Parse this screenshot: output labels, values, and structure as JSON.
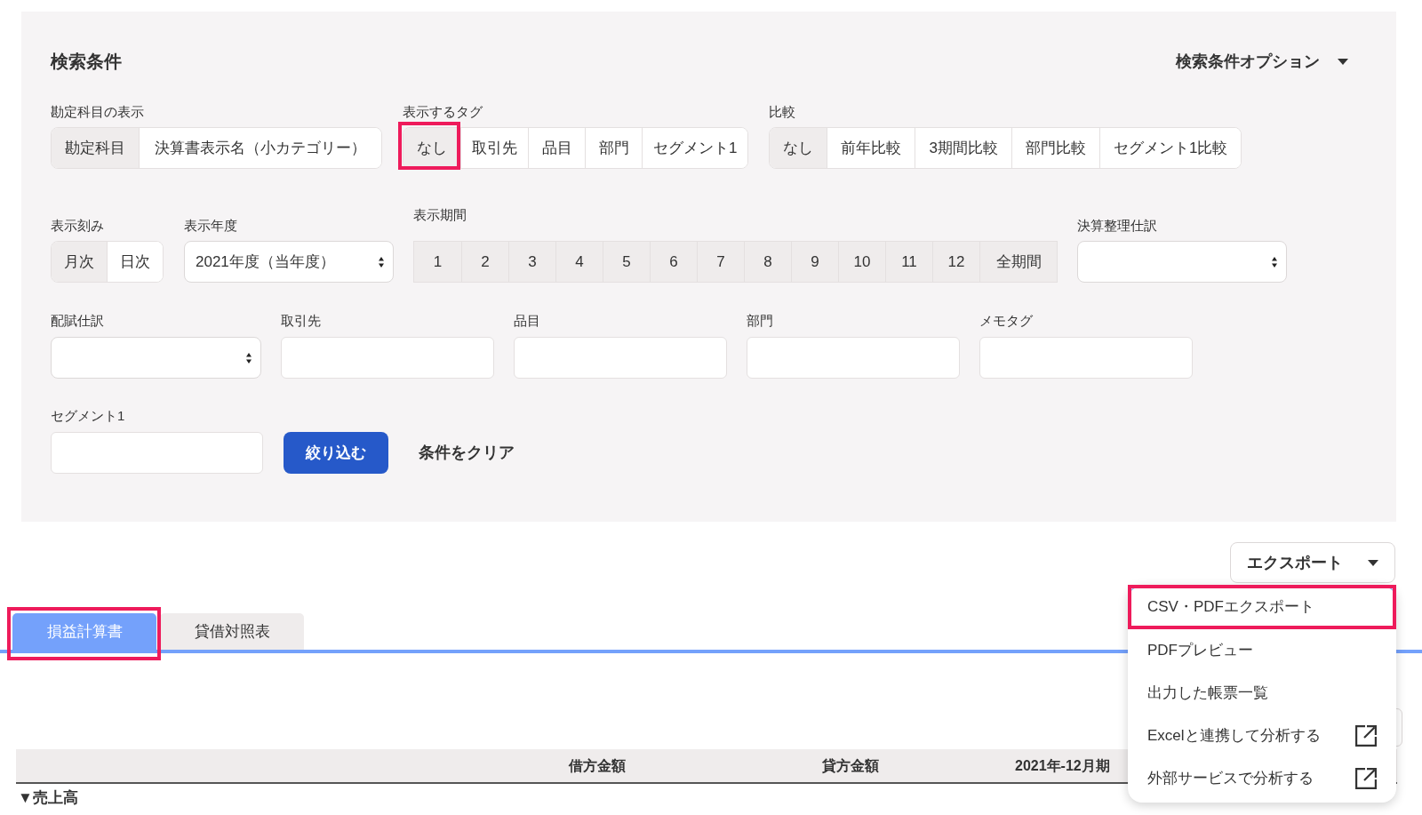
{
  "search_panel": {
    "title": "検索条件",
    "options_toggle": "検索条件オプション",
    "account_display": {
      "label": "勘定科目の表示",
      "options": [
        {
          "label": "勘定科目",
          "selected": true
        },
        {
          "label": "決算書表示名（小カテゴリー）",
          "selected": false
        }
      ]
    },
    "display_tags": {
      "label": "表示するタグ",
      "options": [
        {
          "label": "なし",
          "selected": true,
          "highlighted": true
        },
        {
          "label": "取引先",
          "selected": false,
          "highlighted": false
        },
        {
          "label": "品目",
          "selected": false,
          "highlighted": false
        },
        {
          "label": "部門",
          "selected": false,
          "highlighted": false
        },
        {
          "label": "セグメント1",
          "selected": false,
          "highlighted": false
        }
      ]
    },
    "comparison": {
      "label": "比較",
      "options": [
        {
          "label": "なし",
          "selected": true
        },
        {
          "label": "前年比較",
          "selected": false
        },
        {
          "label": "3期間比較",
          "selected": false
        },
        {
          "label": "部門比較",
          "selected": false
        },
        {
          "label": "セグメント1比較",
          "selected": false
        }
      ]
    },
    "granularity": {
      "label": "表示刻み",
      "options": [
        {
          "label": "月次",
          "selected": true
        },
        {
          "label": "日次",
          "selected": false
        }
      ]
    },
    "fiscal_year": {
      "label": "表示年度",
      "value": "2021年度（当年度）"
    },
    "period": {
      "label": "表示期間",
      "options": [
        {
          "label": "1",
          "selected": true
        },
        {
          "label": "2",
          "selected": true
        },
        {
          "label": "3",
          "selected": true
        },
        {
          "label": "4",
          "selected": true
        },
        {
          "label": "5",
          "selected": true
        },
        {
          "label": "6",
          "selected": true
        },
        {
          "label": "7",
          "selected": true
        },
        {
          "label": "8",
          "selected": true
        },
        {
          "label": "9",
          "selected": true
        },
        {
          "label": "10",
          "selected": true
        },
        {
          "label": "11",
          "selected": true
        },
        {
          "label": "12",
          "selected": true
        },
        {
          "label": "全期間",
          "selected": true
        }
      ]
    },
    "closing_entries": {
      "label": "決算整理仕訳"
    },
    "allocation_entries": {
      "label": "配賦仕訳"
    },
    "filters": [
      {
        "label": "取引先"
      },
      {
        "label": "品目"
      },
      {
        "label": "部門"
      },
      {
        "label": "メモタグ"
      }
    ],
    "segment1": {
      "label": "セグメント1"
    },
    "apply_button": "絞り込む",
    "clear_link": "条件をクリア"
  },
  "export": {
    "label": "エクスポート",
    "expanded": true,
    "menu": [
      {
        "label": "CSV・PDFエクスポート",
        "kind": "internal",
        "highlighted": true
      },
      {
        "label": "PDFプレビュー",
        "kind": "internal",
        "highlighted": false
      },
      {
        "label": "出力した帳票一覧",
        "kind": "internal",
        "highlighted": false
      },
      {
        "label": "Excelと連携して分析する",
        "kind": "external",
        "highlighted": false
      },
      {
        "label": "外部サービスで分析する",
        "kind": "external",
        "highlighted": false
      }
    ]
  },
  "tabs": [
    {
      "label": "損益計算書",
      "selected": true,
      "highlighted": true
    },
    {
      "label": "貸借対照表",
      "selected": false,
      "highlighted": false
    }
  ],
  "table": {
    "columns": [
      "借方金額",
      "貸方金額",
      "2021年-12月期"
    ],
    "rows": [
      {
        "toggle": "▼",
        "label": "売上高"
      }
    ]
  }
}
